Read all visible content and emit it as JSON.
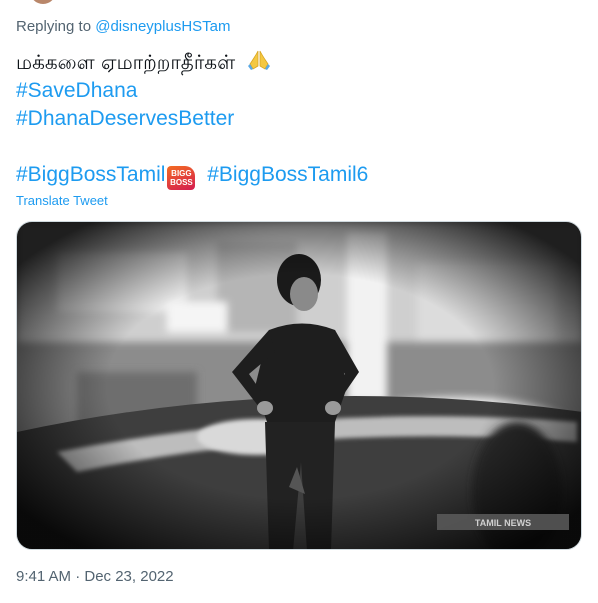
{
  "reply": {
    "prefix": "Replying to",
    "handle": "@disneyplusHSTam"
  },
  "tweet": {
    "tamil_text": "மக்களை ஏமாற்றாதீர்கள்",
    "emoji": "folded-hands-emoji",
    "hashtags": [
      "#SaveDhana",
      "#DhanaDeservesBetter",
      "#BiggBossTamil",
      "#BiggBossTamil6"
    ],
    "badge_text_line1": "BIGG",
    "badge_text_line2": "BOSS"
  },
  "translate_label": "Translate Tweet",
  "media": {
    "watermark": "TAMIL NEWS"
  },
  "timestamp": "9:41 AM · Dec 23, 2022",
  "colors": {
    "link": "#1d9bf0",
    "muted": "#536471",
    "text": "#0f1419"
  }
}
